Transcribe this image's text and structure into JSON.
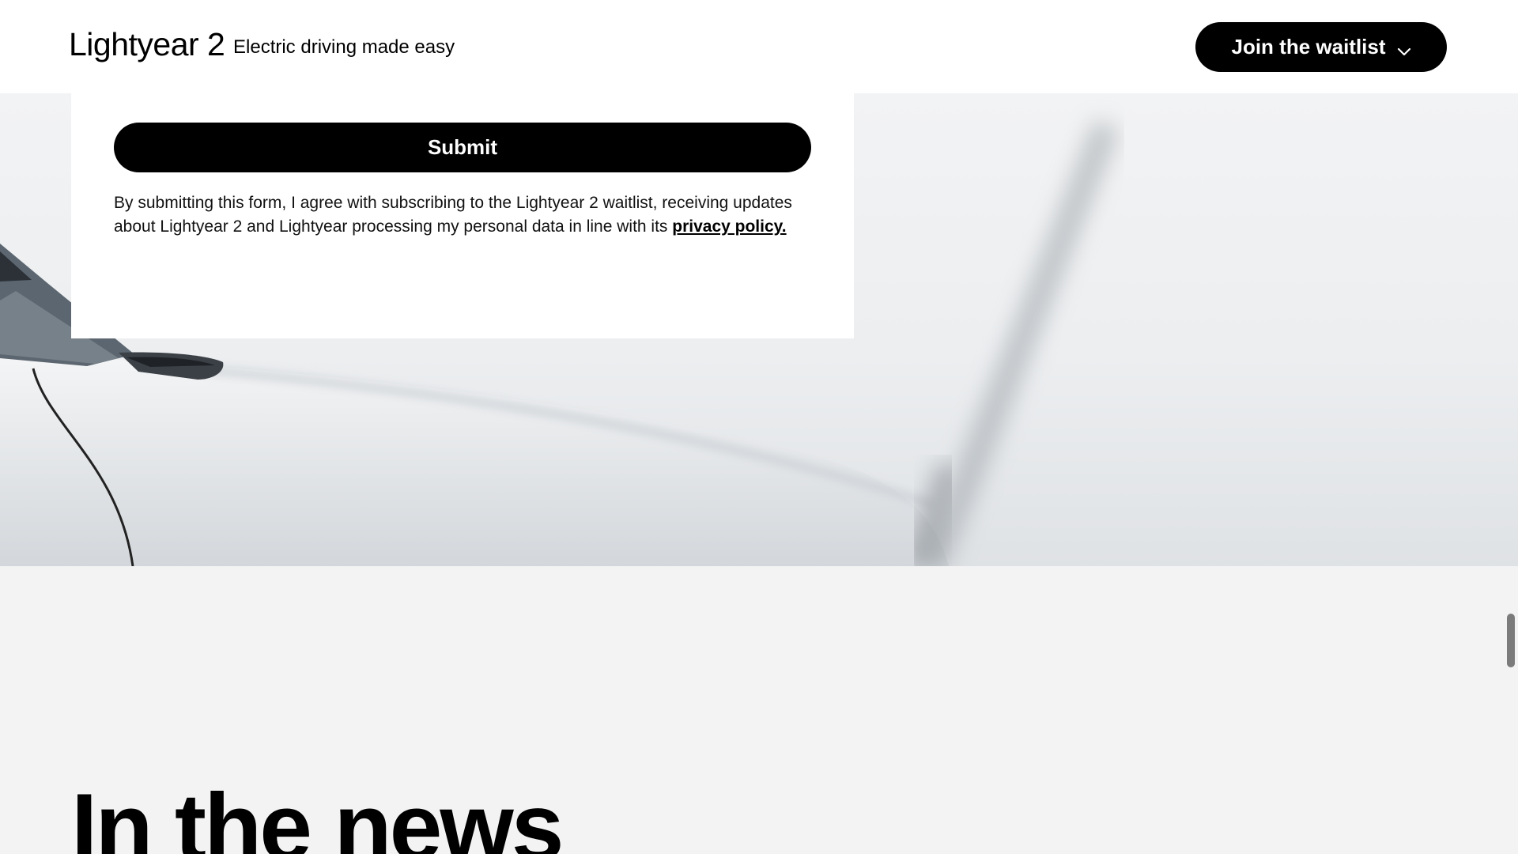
{
  "header": {
    "brand": "Lightyear 2",
    "tagline": "Electric driving made easy",
    "waitlist_label": "Join the waitlist"
  },
  "form": {
    "submit_label": "Submit",
    "consent_text": "By submitting this form, I agree with subscribing to the Lightyear 2 waitlist, receiving updates about Lightyear 2 and Lightyear processing my personal data in line with its ",
    "privacy_link": "privacy policy."
  },
  "news": {
    "title": "In the news"
  },
  "icons": {
    "waitlist_chevron": "chevron-down-icon"
  },
  "colors": {
    "button_bg": "#000000",
    "button_text": "#ffffff",
    "page_bg": "#f3f3f4"
  }
}
